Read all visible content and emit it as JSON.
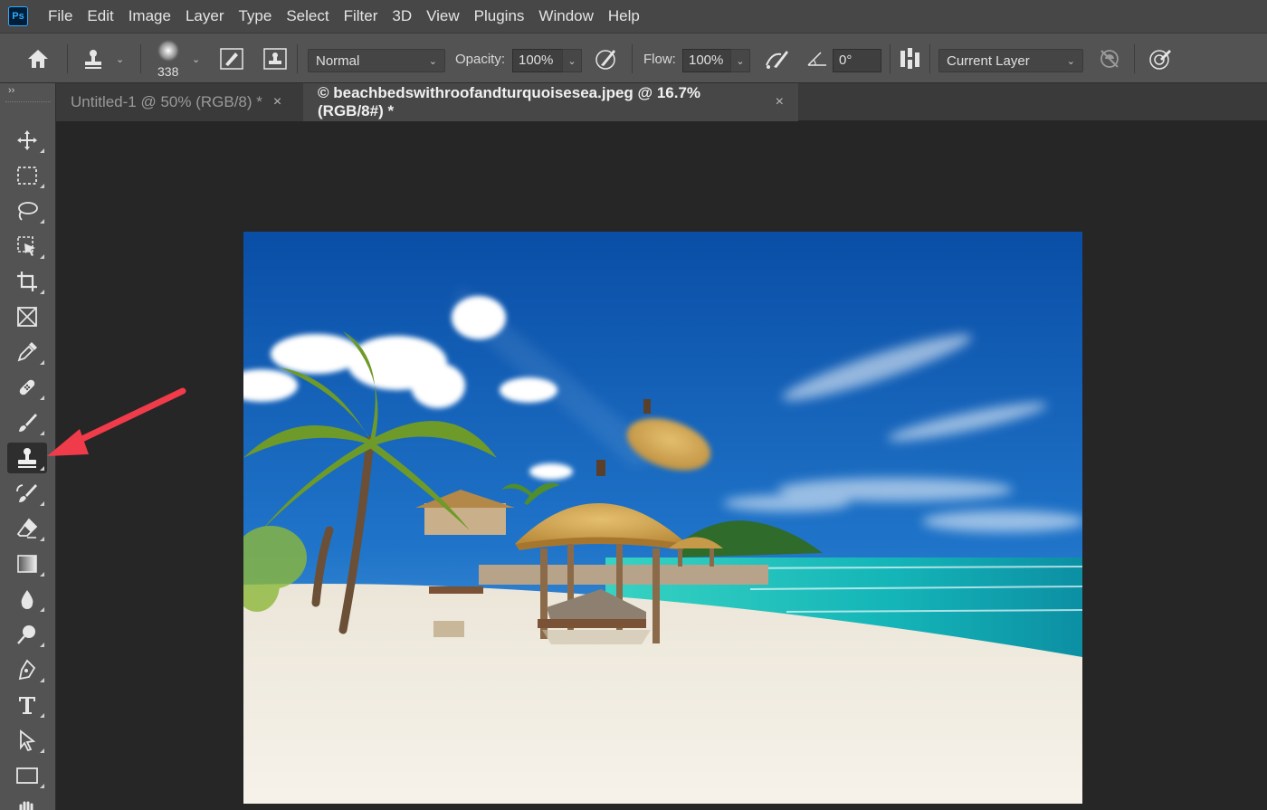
{
  "app": {
    "logo": "Ps"
  },
  "menu": [
    "File",
    "Edit",
    "Image",
    "Layer",
    "Type",
    "Select",
    "Filter",
    "3D",
    "View",
    "Plugins",
    "Window",
    "Help"
  ],
  "options": {
    "brush_size": "338",
    "mode": "Normal",
    "opacity_label": "Opacity:",
    "opacity": "100%",
    "flow_label": "Flow:",
    "flow": "100%",
    "angle": "0°",
    "sample": "Current Layer"
  },
  "toolbar": {
    "collapse": "››",
    "tools": [
      "move-icon",
      "marquee-icon",
      "lasso-icon",
      "object-select-icon",
      "crop-icon",
      "frame-icon",
      "eyedropper-icon",
      "healing-icon",
      "brush-icon",
      "clone-stamp-icon",
      "history-brush-icon",
      "eraser-icon",
      "gradient-icon",
      "blur-icon",
      "dodge-icon",
      "pen-icon",
      "type-icon",
      "path-select-icon",
      "rectangle-icon",
      "hand-icon"
    ],
    "active_tool": "clone-stamp-icon"
  },
  "tabs": [
    {
      "label": "Untitled-1 @ 50% (RGB/8) *",
      "close": "×",
      "active": false
    },
    {
      "label": "© beachbedswithroofandturquoisesea.jpeg @ 16.7% (RGB/8#) *",
      "close": "×",
      "active": true
    }
  ],
  "annotation": {
    "color": "#ef3b4a"
  }
}
